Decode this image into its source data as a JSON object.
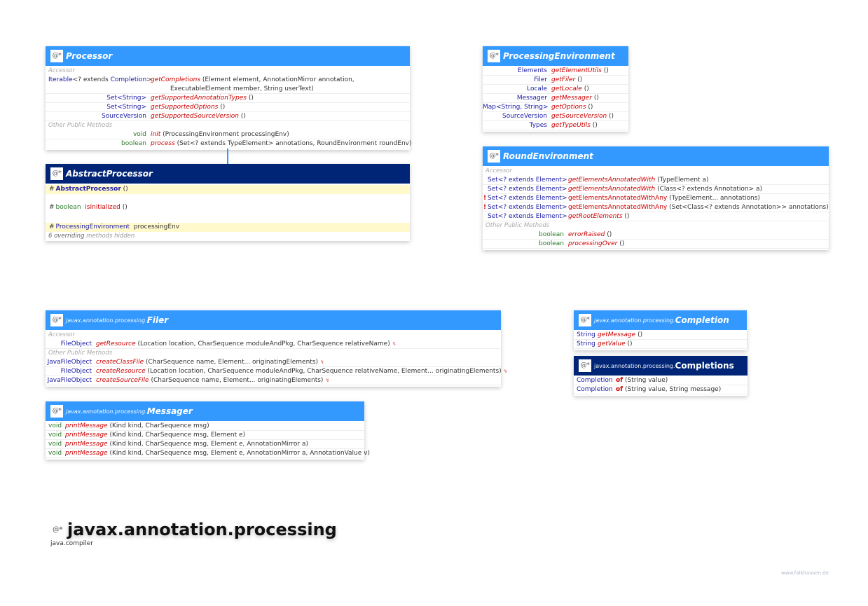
{
  "badge": "@*",
  "processor": {
    "name": "Processor",
    "sections": {
      "accessor": "Accessor",
      "other": "Other Public Methods"
    },
    "accessors": [
      {
        "ret_type": "Iterable",
        "ret_rest": "<? extends ",
        "ret_type2": "Completion",
        "ret_end": ">",
        "method": "getCompletions",
        "params_line1": "(Element element, AnnotationMirror annotation,",
        "params_line2": "ExecutableElement member, String userText)"
      },
      {
        "ret": "Set<String>",
        "method": "getSupportedAnnotationTypes",
        "params": "()"
      },
      {
        "ret": "Set<String>",
        "method": "getSupportedOptions",
        "params": "()"
      },
      {
        "ret": "SourceVersion",
        "method": "getSupportedSourceVersion",
        "params": "()"
      }
    ],
    "others": [
      {
        "ret": "void",
        "method": "init",
        "params": "(ProcessingEnvironment processingEnv)"
      },
      {
        "ret": "boolean",
        "method": "process",
        "params": "(Set<? extends TypeElement> annotations, RoundEnvironment roundEnv)"
      }
    ]
  },
  "abstract_processor": {
    "name": "AbstractProcessor",
    "members": [
      {
        "modifier": "#",
        "name": "AbstractProcessor",
        "params": "()"
      },
      {
        "modifier": "#",
        "type": "boolean",
        "name": "isInitialized",
        "params": "()"
      },
      {
        "modifier": "#",
        "type": "ProcessingEnvironment",
        "name": "processingEnv"
      }
    ],
    "hidden_note_bold": "6 overriding",
    "hidden_note_rest": "methods hidden"
  },
  "processing_environment": {
    "name": "ProcessingEnvironment",
    "methods": [
      {
        "ret": "Elements",
        "method": "getElementUtils",
        "params": "()"
      },
      {
        "ret": "Filer",
        "method": "getFiler",
        "params": "()"
      },
      {
        "ret": "Locale",
        "method": "getLocale",
        "params": "()"
      },
      {
        "ret": "Messager",
        "method": "getMessager",
        "params": "()"
      },
      {
        "ret": "Map<String, String>",
        "method": "getOptions",
        "params": "()"
      },
      {
        "ret": "SourceVersion",
        "method": "getSourceVersion",
        "params": "()"
      },
      {
        "ret": "Types",
        "method": "getTypeUtils",
        "params": "()"
      }
    ]
  },
  "round_environment": {
    "name": "RoundEnvironment",
    "sections": {
      "accessor": "Accessor",
      "other": "Other Public Methods"
    },
    "accessors": [
      {
        "flag": "",
        "ret": "Set<? extends Element>",
        "method": "getElementsAnnotatedWith",
        "params": "(TypeElement a)",
        "italic": true
      },
      {
        "flag": "",
        "ret": "Set<? extends Element>",
        "method": "getElementsAnnotatedWith",
        "params": "(Class<? extends Annotation> a)",
        "italic": true
      },
      {
        "flag": "!",
        "ret": "Set<? extends Element>",
        "method": "getElementsAnnotatedWithAny",
        "params": "(TypeElement... annotations)",
        "italic": false
      },
      {
        "flag": "!",
        "ret": "Set<? extends Element>",
        "method": "getElementsAnnotatedWithAny",
        "params": "(Set<Class<? extends Annotation>> annotations)",
        "italic": false
      },
      {
        "flag": "",
        "ret": "Set<? extends Element>",
        "method": "getRootElements",
        "params": "()",
        "italic": true
      }
    ],
    "others": [
      {
        "ret": "boolean",
        "method": "errorRaised",
        "params": "()"
      },
      {
        "ret": "boolean",
        "method": "processingOver",
        "params": "()"
      }
    ]
  },
  "filer": {
    "package": "javax.annotation.processing.",
    "name": "Filer",
    "sections": {
      "accessor": "Accessor",
      "other": "Other Public Methods"
    },
    "accessors": [
      {
        "ret": "FileObject",
        "method": "getResource",
        "params": "(Location location, CharSequence moduleAndPkg, CharSequence relativeName)",
        "throws": "↯"
      }
    ],
    "others": [
      {
        "ret": "JavaFileObject",
        "method": "createClassFile",
        "params": "(CharSequence name, Element... originatingElements)",
        "throws": "↯"
      },
      {
        "ret": "FileObject",
        "method": "createResource",
        "params": "(Location location, CharSequence moduleAndPkg, CharSequence relativeName, Element... originatingElements)",
        "throws": "↯"
      },
      {
        "ret": "JavaFileObject",
        "method": "createSourceFile",
        "params": "(CharSequence name, Element... originatingElements)",
        "throws": "↯"
      }
    ]
  },
  "messager": {
    "package": "javax.annotation.processing.",
    "name": "Messager",
    "methods": [
      {
        "ret": "void",
        "method": "printMessage",
        "params": "(Kind kind, CharSequence msg)"
      },
      {
        "ret": "void",
        "method": "printMessage",
        "params": "(Kind kind, CharSequence msg, Element e)"
      },
      {
        "ret": "void",
        "method": "printMessage",
        "params": "(Kind kind, CharSequence msg, Element e, AnnotationMirror a)"
      },
      {
        "ret": "void",
        "method": "printMessage",
        "params": "(Kind kind, CharSequence msg, Element e, AnnotationMirror a, AnnotationValue v)"
      }
    ]
  },
  "completion": {
    "package": "javax.annotation.processing.",
    "name": "Completion",
    "methods": [
      {
        "ret": "String",
        "method": "getMessage",
        "params": "()"
      },
      {
        "ret": "String",
        "method": "getValue",
        "params": "()"
      }
    ]
  },
  "completions": {
    "package": "javax.annotation.processing.",
    "name": "Completions",
    "methods": [
      {
        "ret": "Completion",
        "method": "of",
        "params": "(String value)"
      },
      {
        "ret": "Completion",
        "method": "of",
        "params": "(String value, String message)"
      }
    ]
  },
  "footer": {
    "package_title": "javax.annotation.processing",
    "module": "java.compiler",
    "credit": "www.falkhausen.de"
  }
}
